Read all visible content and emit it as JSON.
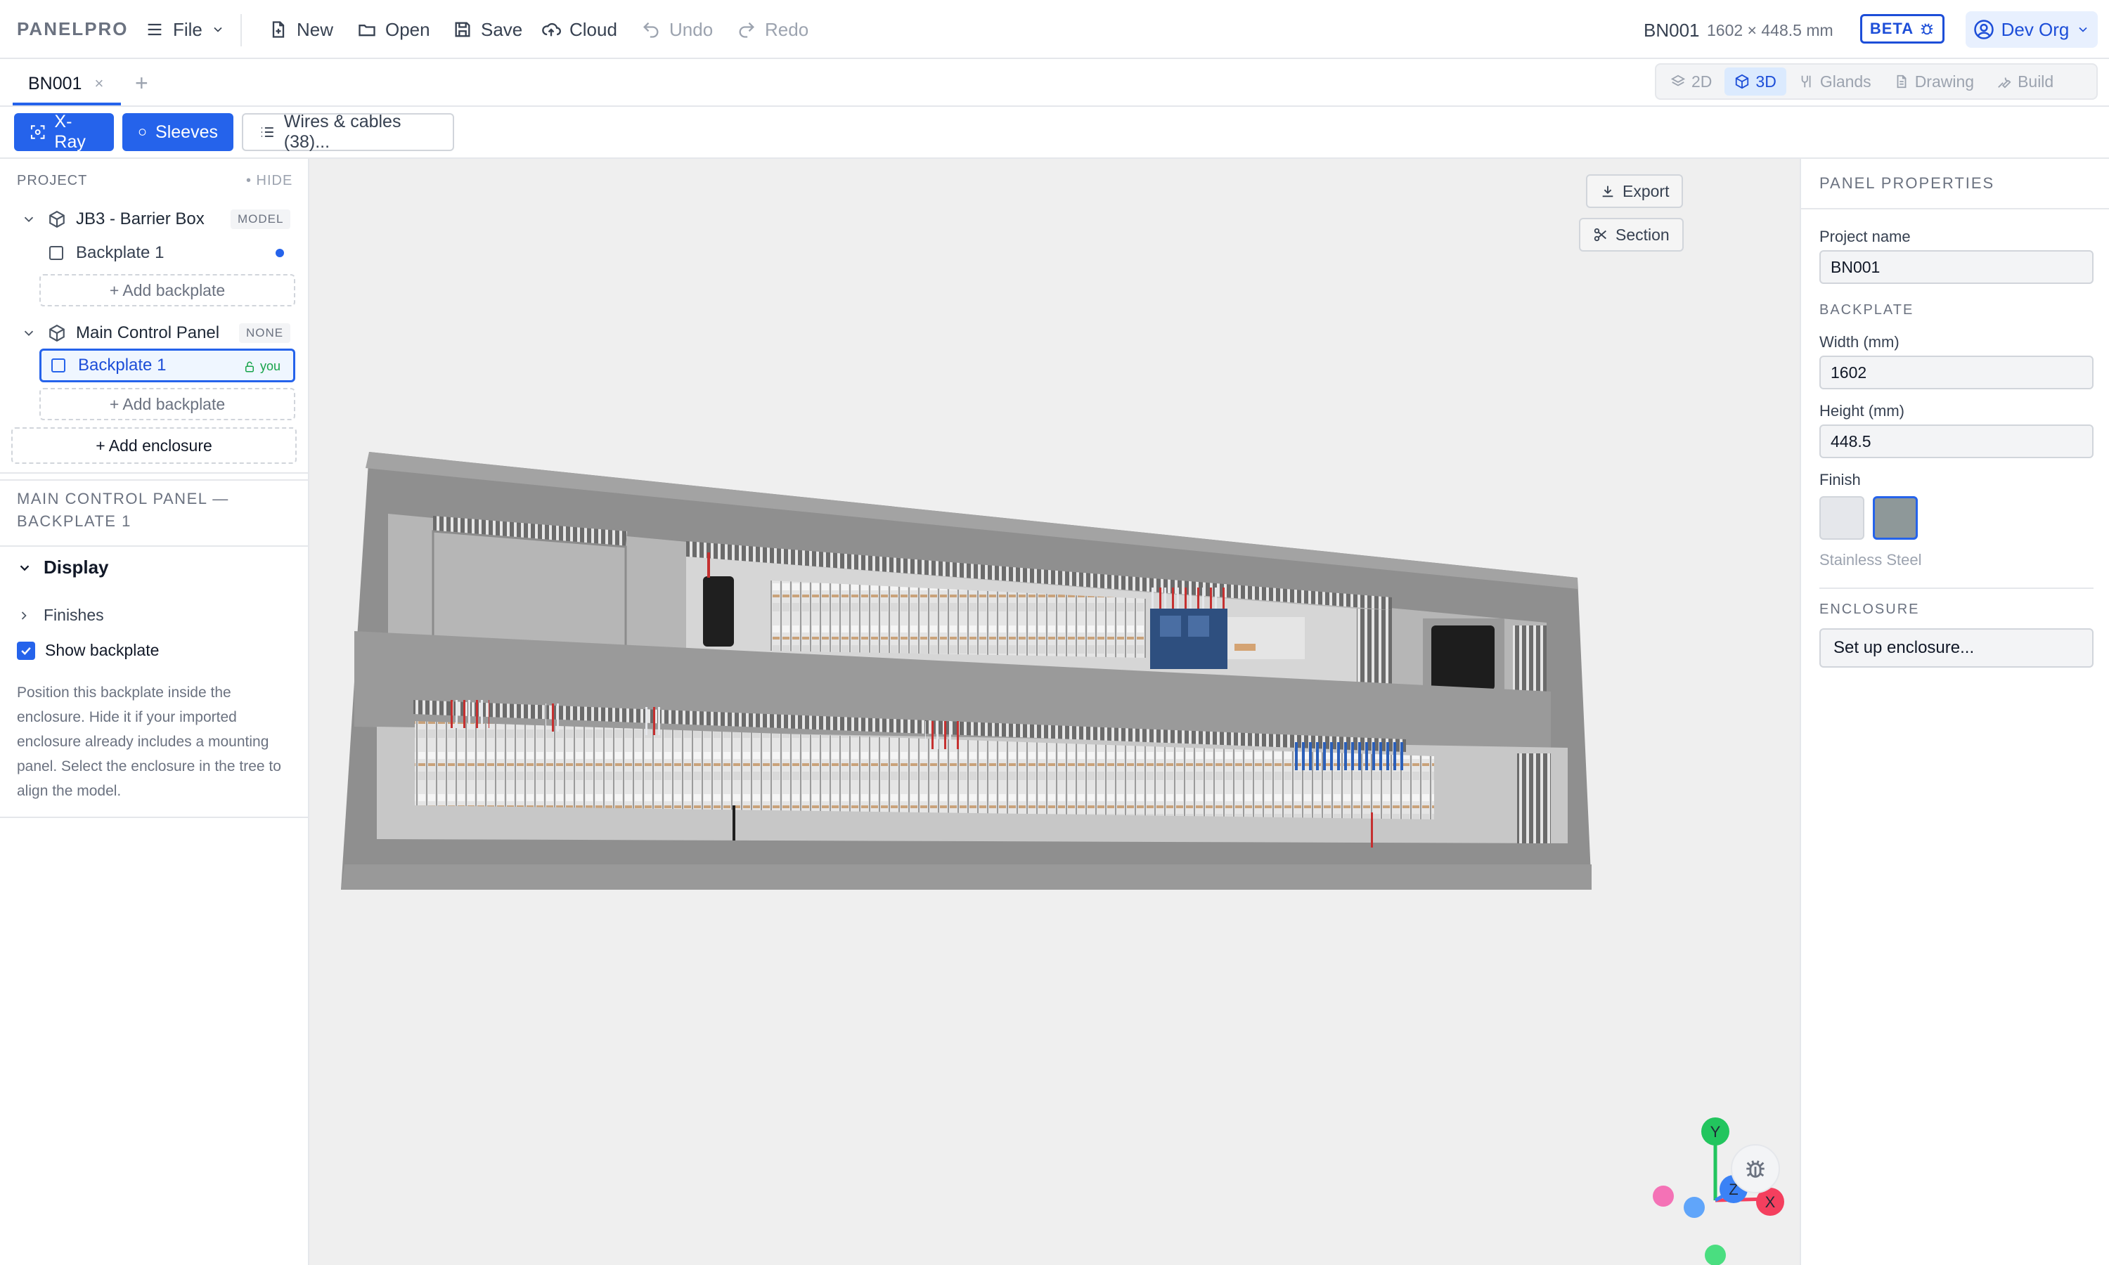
{
  "app": {
    "brand": "PANELPRO"
  },
  "toolbar": {
    "file": "File",
    "new": "New",
    "open": "Open",
    "save": "Save",
    "cloud": "Cloud",
    "undo": "Undo",
    "redo": "Redo",
    "project_id": "BN001",
    "dimensions": "1602 × 448.5 mm",
    "beta": "BETA",
    "org": "Dev Org"
  },
  "tabs": {
    "active": "BN001",
    "close": "×",
    "add": "+"
  },
  "view_modes": [
    {
      "label": "2D",
      "active": false
    },
    {
      "label": "3D",
      "active": true
    },
    {
      "label": "Glands",
      "active": false
    },
    {
      "label": "Drawing",
      "active": false
    },
    {
      "label": "Build",
      "active": false
    }
  ],
  "tools": {
    "xray": "X-Ray",
    "sleeves": "Sleeves",
    "wires": "Wires & cables (38)..."
  },
  "project_tree": {
    "heading": "PROJECT",
    "hide": "• HIDE",
    "enclosures": [
      {
        "name": "JB3 - Barrier Box",
        "badge": "MODEL",
        "backplates": [
          {
            "name": "Backplate 1",
            "status": "dot"
          }
        ],
        "add_backplate": "+ Add backplate"
      },
      {
        "name": "Main Control Panel",
        "badge": "NONE",
        "backplates": [
          {
            "name": "Backplate 1",
            "status": "you",
            "you_label": "you"
          }
        ],
        "add_backplate": "+ Add backplate"
      }
    ],
    "add_enclosure": "+ Add enclosure"
  },
  "section": {
    "title": "MAIN CONTROL PANEL — BACKPLATE 1",
    "display": "Display",
    "finishes": "Finishes",
    "show_backplate": "Show backplate",
    "show_backplate_checked": true,
    "help": "Position this backplate inside the enclosure. Hide it if your imported enclosure already includes a mounting panel. Select the enclosure in the tree to align the model."
  },
  "viewport": {
    "export": "Export",
    "section": "Section",
    "axes": {
      "y": "Y",
      "z": "Z",
      "x": "X"
    }
  },
  "panel_properties": {
    "heading": "PANEL PROPERTIES",
    "project_name_label": "Project name",
    "project_name": "BN001",
    "backplate_caption": "BACKPLATE",
    "width_label": "Width (mm)",
    "width": "1602",
    "height_label": "Height (mm)",
    "height": "448.5",
    "finish_label": "Finish",
    "finish_options": [
      {
        "color": "#e5e7eb",
        "selected": false
      },
      {
        "color": "#8e9899",
        "selected": true
      }
    ],
    "finish_value": "Stainless Steel",
    "enclosure_caption": "ENCLOSURE",
    "enclosure_button": "Set up enclosure..."
  }
}
